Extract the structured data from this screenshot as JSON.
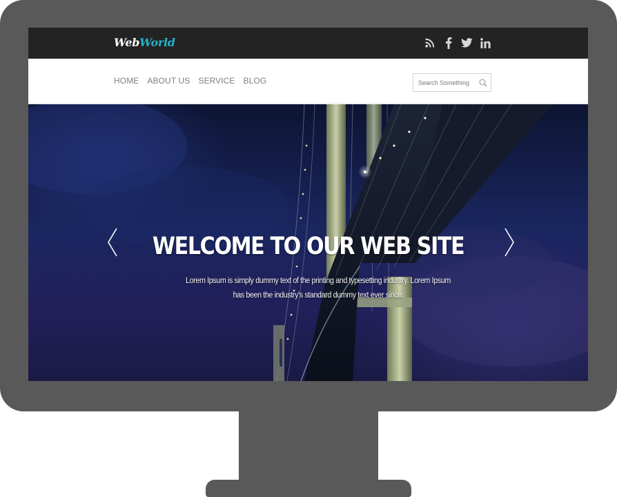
{
  "header": {
    "logo": {
      "part1": "Web",
      "part2": "World",
      "accent_color": "#22b3c9"
    },
    "social_icons": [
      "rss-icon",
      "facebook-icon",
      "twitter-icon",
      "linkedin-icon"
    ]
  },
  "nav": {
    "items": [
      {
        "label": "HOME"
      },
      {
        "label": "ABOUT US"
      },
      {
        "label": "SERVICE"
      },
      {
        "label": "BLOG"
      }
    ],
    "search": {
      "placeholder": "Search Something",
      "value": ""
    }
  },
  "hero": {
    "title": "WELCOME TO OUR WEB SITE",
    "text": "Lorem Ipsum is simply dummy text of the printing and typesetting industry. Lorem Ipsum has been the industry's standard dummy text ever since.",
    "prev_icon": "chevron-left-icon",
    "next_icon": "chevron-right-icon"
  },
  "colors": {
    "frame": "#595959",
    "topbar": "#232323",
    "nav_text": "#7f7f7f"
  }
}
